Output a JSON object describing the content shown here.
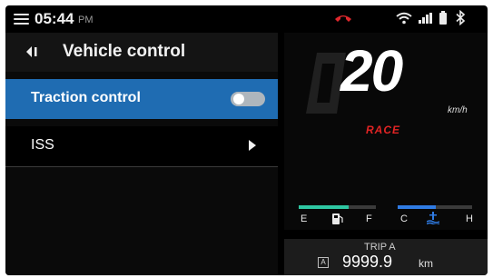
{
  "status_bar": {
    "time": "05:44",
    "ampm": "PM",
    "icons": [
      "menu-icon",
      "call-end-icon",
      "wifi-icon",
      "signal-icon",
      "battery-icon",
      "bluetooth-icon"
    ],
    "call_icon_color": "#e0282d"
  },
  "menu": {
    "title": "Vehicle control",
    "items": [
      {
        "label": "Traction control",
        "type": "toggle",
        "selected": true,
        "toggle_on": false
      },
      {
        "label": "ISS",
        "type": "submenu",
        "selected": false
      }
    ],
    "selected_color": "#1f6cb2"
  },
  "dashboard": {
    "speed": "20",
    "speed_unit": "km/h",
    "ride_mode": "RACE",
    "ride_mode_color": "#e22424",
    "fuel_gauge": {
      "min_label": "E",
      "max_label": "F",
      "icon": "fuel-pump-icon",
      "color": "#2ec7a2"
    },
    "temp_gauge": {
      "min_label": "C",
      "max_label": "H",
      "icon": "coolant-temp-icon",
      "color": "#2f7be3"
    }
  },
  "trip": {
    "title": "TRIP A",
    "badge": "A",
    "value": "9999.9",
    "unit": "km"
  }
}
